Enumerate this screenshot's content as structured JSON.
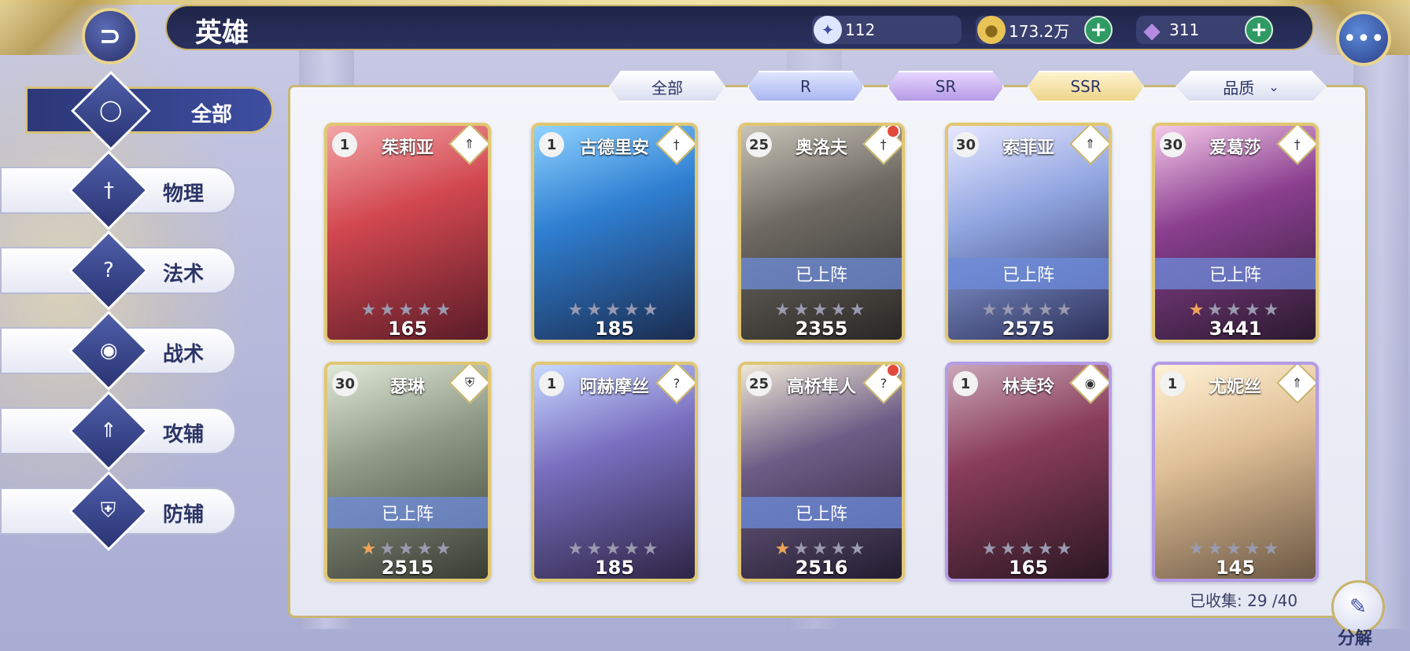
{
  "header": {
    "title": "英雄",
    "back_icon": "back-arrow-icon",
    "chat_icon": "chat-bubble-icon"
  },
  "currencies": [
    {
      "name": "stamina",
      "icon": "compass-icon",
      "value": "112"
    },
    {
      "name": "gold",
      "icon": "coin-icon",
      "value": "173.2万"
    },
    {
      "name": "diamond",
      "icon": "diamond-icon",
      "value": "311"
    }
  ],
  "sidebar": {
    "items": [
      {
        "label": "全部",
        "icon": "ring-icon",
        "active": true
      },
      {
        "label": "物理",
        "icon": "sword-icon"
      },
      {
        "label": "法术",
        "icon": "question-rune-icon"
      },
      {
        "label": "战术",
        "icon": "eye-icon"
      },
      {
        "label": "攻辅",
        "icon": "spear-icon"
      },
      {
        "label": "防辅",
        "icon": "shield-icon"
      }
    ]
  },
  "filters": {
    "all": "全部",
    "r": "R",
    "sr": "SR",
    "ssr": "SSR",
    "quality": "品质"
  },
  "heroes": [
    {
      "name": "茱莉亚",
      "level": "1",
      "class_icon": "spear-icon",
      "deployed": false,
      "stars_lit": 0,
      "power": "165",
      "rarity": "SSR",
      "notify": false
    },
    {
      "name": "古德里安",
      "level": "1",
      "class_icon": "sword-icon",
      "deployed": false,
      "stars_lit": 0,
      "power": "185",
      "rarity": "SSR",
      "notify": false
    },
    {
      "name": "奥洛夫",
      "level": "25",
      "class_icon": "sword-icon",
      "deployed": true,
      "stars_lit": 0,
      "power": "2355",
      "rarity": "SSR",
      "notify": true
    },
    {
      "name": "索菲亚",
      "level": "30",
      "class_icon": "spear-icon",
      "deployed": true,
      "stars_lit": 0,
      "power": "2575",
      "rarity": "SSR",
      "notify": false
    },
    {
      "name": "爱葛莎",
      "level": "30",
      "class_icon": "sword-icon",
      "deployed": true,
      "stars_lit": 1,
      "power": "3441",
      "rarity": "SSR",
      "notify": false
    },
    {
      "name": "瑟琳",
      "level": "30",
      "class_icon": "shield-icon",
      "deployed": true,
      "stars_lit": 1,
      "power": "2515",
      "rarity": "SSR",
      "notify": false
    },
    {
      "name": "阿赫摩丝",
      "level": "1",
      "class_icon": "question-rune-icon",
      "deployed": false,
      "stars_lit": 0,
      "power": "185",
      "rarity": "SSR",
      "notify": false
    },
    {
      "name": "高桥隼人",
      "level": "25",
      "class_icon": "question-rune-icon",
      "deployed": true,
      "stars_lit": 1,
      "power": "2516",
      "rarity": "SSR",
      "notify": true
    },
    {
      "name": "林美玲",
      "level": "1",
      "class_icon": "eye-icon",
      "deployed": false,
      "stars_lit": 0,
      "power": "165",
      "rarity": "SR",
      "notify": false
    },
    {
      "name": "尤妮丝",
      "level": "1",
      "class_icon": "spear-icon",
      "deployed": false,
      "stars_lit": 0,
      "power": "145",
      "rarity": "SR",
      "notify": false
    }
  ],
  "deployed_label": "已上阵",
  "collection": {
    "label": "已收集:",
    "count": "29 /40"
  },
  "decompose": {
    "label": "分解",
    "icon": "decompose-icon"
  },
  "colors": {
    "gold_frame": "#e1c772",
    "sr_frame": "#b49be6",
    "navy": "#2b3777",
    "plus_green": "#2f9a63",
    "notify_red": "#e24a3b"
  }
}
